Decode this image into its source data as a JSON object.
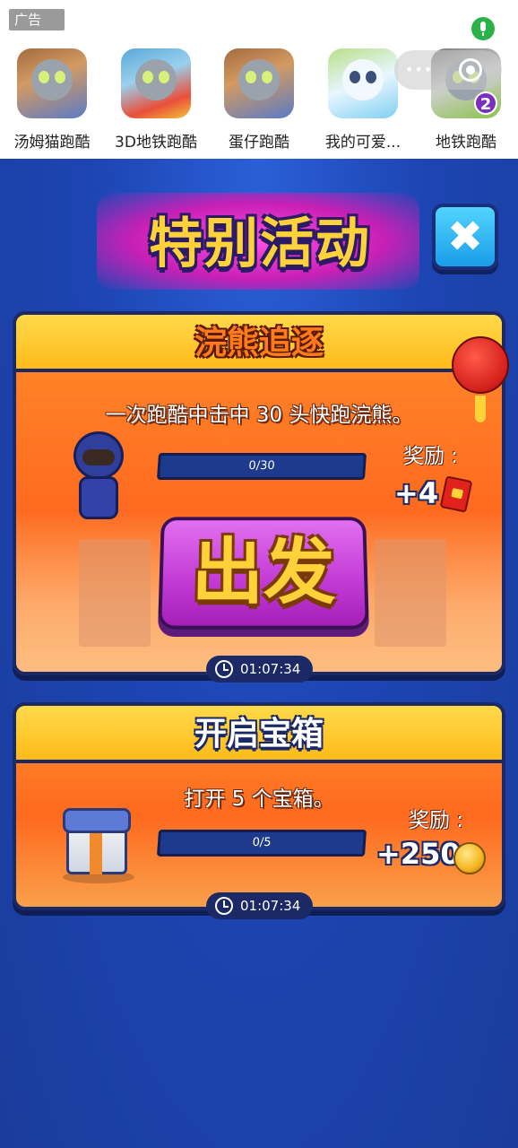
{
  "ad": {
    "tag": "广告",
    "apps": [
      {
        "label": "汤姆猫跑酷",
        "icon": "talking-tom-runner-icon"
      },
      {
        "label": "3D地铁跑酷",
        "icon": "talking-tom-gold-icon"
      },
      {
        "label": "蛋仔跑酷",
        "icon": "talking-tom-runner-icon"
      },
      {
        "label": "我的可爱...",
        "icon": "cute-pet-icon"
      },
      {
        "label": "地铁跑酷",
        "icon": "talking-tom-2-icon"
      }
    ],
    "badge": "2"
  },
  "header": {
    "title": "特别活动",
    "close_icon": "✖"
  },
  "events": [
    {
      "title": "浣熊追逐",
      "description": "一次跑酷中击中 30 头快跑浣熊。",
      "progress_text": "0/30",
      "progress_fraction": 0,
      "reward_label": "奖励 :",
      "reward_amount": "+4",
      "reward_icon": "red-packet-icon",
      "button_label": "出发",
      "timer": "01:07:34"
    },
    {
      "title": "开启宝箱",
      "description": "打开 5 个宝箱。",
      "progress_text": "0/5",
      "progress_fraction": 0,
      "reward_label": "奖励 :",
      "reward_amount": "+250",
      "reward_icon": "coin-icon",
      "timer": "01:07:34"
    }
  ],
  "colors": {
    "background": "#1b3fa8",
    "card_orange": "#ff6a1f",
    "header_yellow": "#ffbb1a",
    "button_purple": "#c13ad4",
    "title_gold": "#ffd23a",
    "close_blue": "#1a9ce8",
    "mic_green": "#2bb14a"
  }
}
